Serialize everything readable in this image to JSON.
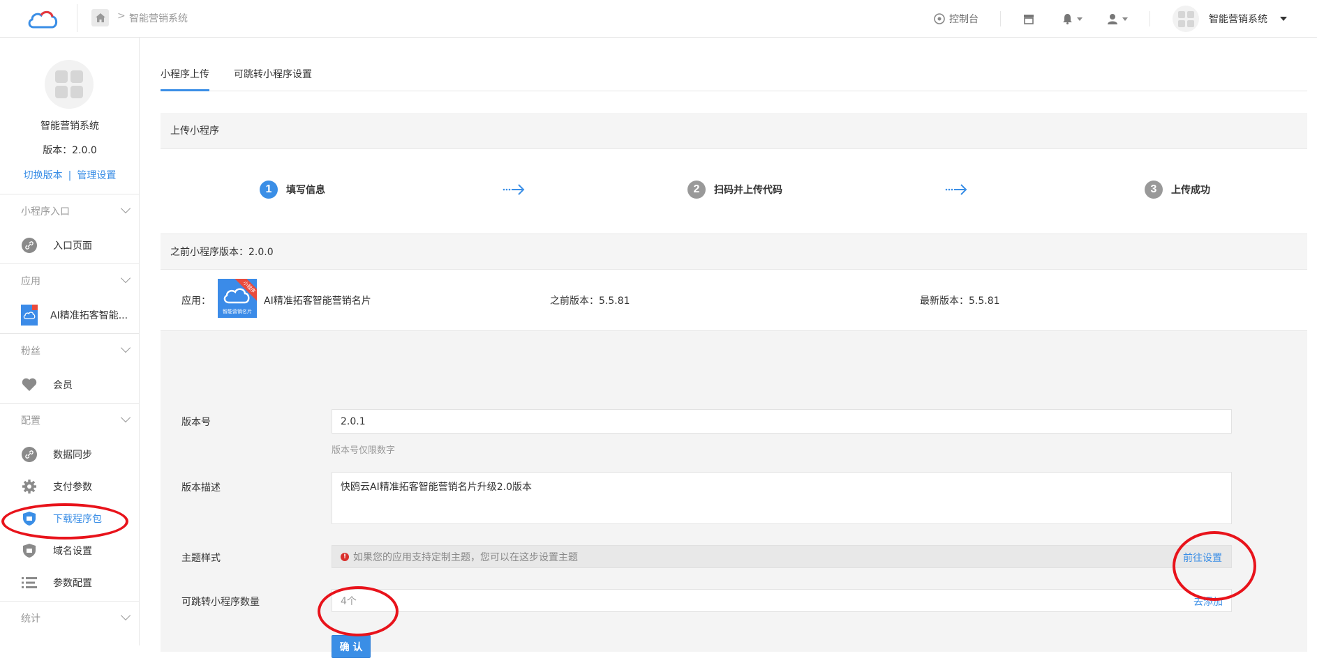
{
  "header": {
    "breadcrumb": "智能营销系统",
    "console_label": "控制台",
    "account_name": "智能营销系统"
  },
  "sidebar": {
    "app_name": "智能营销系统",
    "version": "版本：2.0.0",
    "switch_version": "切换版本",
    "link_separator": "|",
    "manage_settings": "管理设置",
    "groups": [
      {
        "title": "小程序入口",
        "items": [
          {
            "label": "入口页面",
            "icon": "link-icon"
          }
        ]
      },
      {
        "title": "应用",
        "items": [
          {
            "label": "AI精准拓客智能...",
            "icon": "app-thumbnail"
          }
        ]
      },
      {
        "title": "粉丝",
        "items": [
          {
            "label": "会员",
            "icon": "heart-icon"
          }
        ]
      },
      {
        "title": "配置",
        "items": [
          {
            "label": "数据同步",
            "icon": "link-icon"
          },
          {
            "label": "支付参数",
            "icon": "gear-icon"
          },
          {
            "label": "下载程序包",
            "icon": "shield-icon"
          },
          {
            "label": "域名设置",
            "icon": "shield-icon"
          },
          {
            "label": "参数配置",
            "icon": "list-icon"
          }
        ]
      },
      {
        "title": "统计",
        "items": []
      }
    ]
  },
  "tabs": [
    {
      "label": "小程序上传",
      "active": true
    },
    {
      "label": "可跳转小程序设置",
      "active": false
    }
  ],
  "upload_panel": {
    "title": "上传小程序",
    "steps": [
      {
        "num": "1",
        "label": "填写信息",
        "active": true
      },
      {
        "num": "2",
        "label": "扫码并上传代码",
        "active": false
      },
      {
        "num": "3",
        "label": "上传成功",
        "active": false
      }
    ]
  },
  "previous_panel": {
    "title": "之前小程序版本：2.0.0",
    "app_label": "应用：",
    "app_name": "AI精准拓客智能营销名片",
    "app_icon_ribbon": "小程序",
    "app_icon_caption": "智能营销名片",
    "previous_version": "之前版本：5.5.81",
    "latest_version": "最新版本：5.5.81"
  },
  "form": {
    "version_label": "版本号",
    "version_value": "2.0.1",
    "version_help": "版本号仅限数字",
    "desc_label": "版本描述",
    "desc_value": "快鸥云AI精准拓客智能营销名片升级2.0版本",
    "theme_label": "主题样式",
    "theme_notice": "如果您的应用支持定制主题，您可以在这步设置主题",
    "theme_link": "前往设置",
    "jump_label": "可跳转小程序数量",
    "jump_value": "4个",
    "jump_link": "去添加",
    "confirm_label": "确 认"
  },
  "colors": {
    "accent": "#3a8ee6",
    "annotation_red": "#e8131b"
  }
}
